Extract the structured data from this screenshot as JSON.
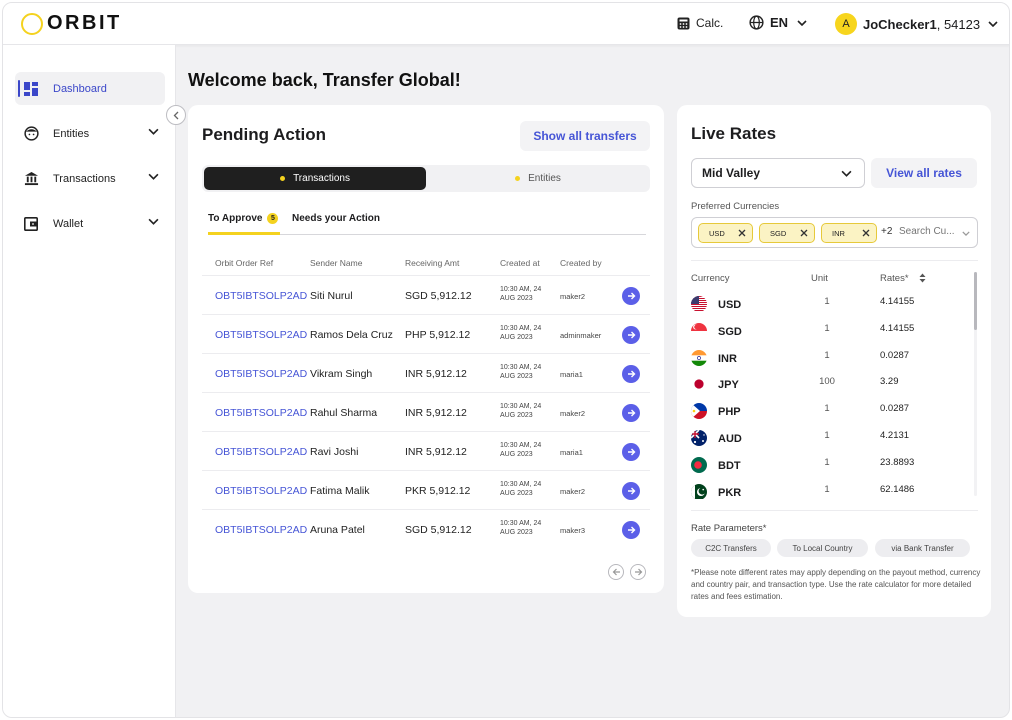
{
  "header": {
    "logo_text": "ORBIT",
    "calc_label": "Calc.",
    "lang_label": "EN",
    "avatar_initial": "A",
    "user_name": "JoChecker1",
    "user_id": ", 54123"
  },
  "sidebar": {
    "items": [
      {
        "label": "Dashboard"
      },
      {
        "label": "Entities"
      },
      {
        "label": "Transactions"
      },
      {
        "label": "Wallet"
      }
    ]
  },
  "main": {
    "welcome": "Welcome back, Transfer Global!"
  },
  "pending": {
    "title": "Pending Action",
    "show_all": "Show all transfers",
    "seg_transactions": "Transactions",
    "seg_entities": "Entities",
    "tab_approve": "To Approve",
    "tab_approve_count": "5",
    "tab_action": "Needs your Action",
    "columns": [
      "Orbit Order Ref",
      "Sender Name",
      "Receiving Amt",
      "Created at",
      "Created by"
    ],
    "rows": [
      {
        "ref": "OBT5IBTSOLP2AD",
        "sender": "Siti Nurul",
        "amt": "SGD 5,912.12",
        "date1": "10:30 AM, 24",
        "date2": "AUG 2023",
        "by": "maker2"
      },
      {
        "ref": "OBT5IBTSOLP2AD",
        "sender": "Ramos Dela Cruz",
        "amt": "PHP 5,912.12",
        "date1": "10:30 AM, 24",
        "date2": "AUG 2023",
        "by": "adminmaker"
      },
      {
        "ref": "OBT5IBTSOLP2AD",
        "sender": "Vikram Singh",
        "amt": "INR 5,912.12",
        "date1": "10:30 AM, 24",
        "date2": "AUG 2023",
        "by": "maria1"
      },
      {
        "ref": "OBT5IBTSOLP2AD",
        "sender": "Rahul Sharma",
        "amt": "INR 5,912.12",
        "date1": "10:30 AM, 24",
        "date2": "AUG 2023",
        "by": "maker2"
      },
      {
        "ref": "OBT5IBTSOLP2AD",
        "sender": "Ravi Joshi",
        "amt": "INR 5,912.12",
        "date1": "10:30 AM, 24",
        "date2": "AUG 2023",
        "by": "maria1"
      },
      {
        "ref": "OBT5IBTSOLP2AD",
        "sender": "Fatima Malik",
        "amt": "PKR 5,912.12",
        "date1": "10:30 AM, 24",
        "date2": "AUG 2023",
        "by": "maker2"
      },
      {
        "ref": "OBT5IBTSOLP2AD",
        "sender": "Aruna Patel",
        "amt": "SGD 5,912.12",
        "date1": "10:30 AM, 24",
        "date2": "AUG 2023",
        "by": "maker3"
      }
    ]
  },
  "rates": {
    "title": "Live Rates",
    "location": "Mid Valley",
    "view_all": "View all rates",
    "pref_label": "Preferred Currencies",
    "chips": [
      "USD",
      "SGD",
      "INR"
    ],
    "more": "+2",
    "search_placeholder": "Search Cu...",
    "col_currency": "Currency",
    "col_unit": "Unit",
    "col_rates": "Rates*",
    "list": [
      {
        "code": "USD",
        "unit": "1",
        "rate": "4.14155",
        "flag": "us-flag-icon"
      },
      {
        "code": "SGD",
        "unit": "1",
        "rate": "4.14155",
        "flag": "sg-flag-icon"
      },
      {
        "code": "INR",
        "unit": "1",
        "rate": "0.0287",
        "flag": "in-flag-icon"
      },
      {
        "code": "JPY",
        "unit": "100",
        "rate": "3.29",
        "flag": "jp-flag-icon"
      },
      {
        "code": "PHP",
        "unit": "1",
        "rate": "0.0287",
        "flag": "ph-flag-icon"
      },
      {
        "code": "AUD",
        "unit": "1",
        "rate": "4.2131",
        "flag": "au-flag-icon"
      },
      {
        "code": "BDT",
        "unit": "1",
        "rate": "23.8893",
        "flag": "bd-flag-icon"
      },
      {
        "code": "PKR",
        "unit": "1",
        "rate": "62.1486",
        "flag": "pk-flag-icon"
      }
    ],
    "params_label": "Rate Parameters*",
    "params": [
      "C2C Transfers",
      "To Local Country",
      "via Bank Transfer"
    ],
    "note": "*Please note different rates may apply depending on the payout method, currency and country pair, and transaction type. Use the rate calculator for more detailed rates and fees estimation."
  },
  "colors": {
    "brand_yellow": "#f4d21f",
    "accent_blue": "#4655d6",
    "arrow_button": "#5b5fe8",
    "dark_segment": "#1f1f1f"
  }
}
